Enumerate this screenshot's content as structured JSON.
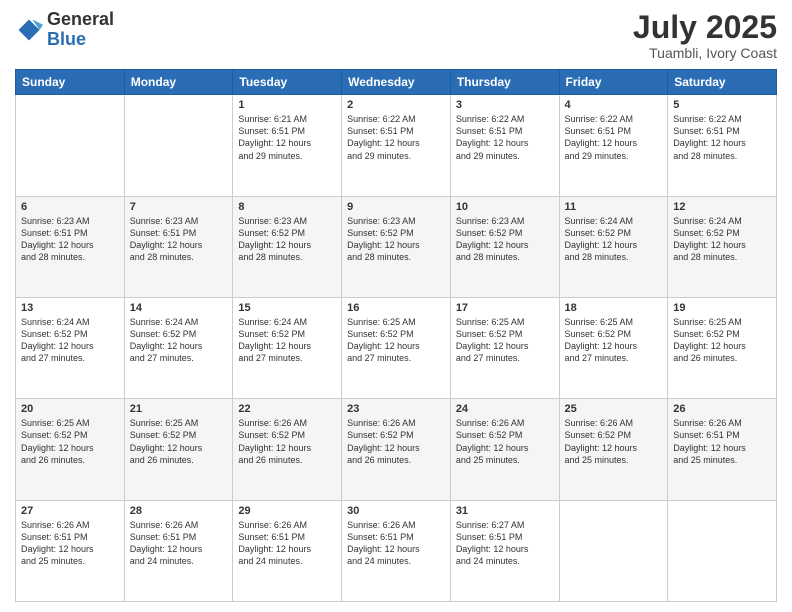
{
  "header": {
    "logo": {
      "general": "General",
      "blue": "Blue"
    },
    "month_year": "July 2025",
    "location": "Tuambli, Ivory Coast"
  },
  "weekdays": [
    "Sunday",
    "Monday",
    "Tuesday",
    "Wednesday",
    "Thursday",
    "Friday",
    "Saturday"
  ],
  "weeks": [
    [
      {
        "day": "",
        "info": ""
      },
      {
        "day": "",
        "info": ""
      },
      {
        "day": "1",
        "sunrise": "6:21 AM",
        "sunset": "6:51 PM",
        "daylight": "12 hours and 29 minutes."
      },
      {
        "day": "2",
        "sunrise": "6:22 AM",
        "sunset": "6:51 PM",
        "daylight": "12 hours and 29 minutes."
      },
      {
        "day": "3",
        "sunrise": "6:22 AM",
        "sunset": "6:51 PM",
        "daylight": "12 hours and 29 minutes."
      },
      {
        "day": "4",
        "sunrise": "6:22 AM",
        "sunset": "6:51 PM",
        "daylight": "12 hours and 29 minutes."
      },
      {
        "day": "5",
        "sunrise": "6:22 AM",
        "sunset": "6:51 PM",
        "daylight": "12 hours and 28 minutes."
      }
    ],
    [
      {
        "day": "6",
        "sunrise": "6:23 AM",
        "sunset": "6:51 PM",
        "daylight": "12 hours and 28 minutes."
      },
      {
        "day": "7",
        "sunrise": "6:23 AM",
        "sunset": "6:51 PM",
        "daylight": "12 hours and 28 minutes."
      },
      {
        "day": "8",
        "sunrise": "6:23 AM",
        "sunset": "6:52 PM",
        "daylight": "12 hours and 28 minutes."
      },
      {
        "day": "9",
        "sunrise": "6:23 AM",
        "sunset": "6:52 PM",
        "daylight": "12 hours and 28 minutes."
      },
      {
        "day": "10",
        "sunrise": "6:23 AM",
        "sunset": "6:52 PM",
        "daylight": "12 hours and 28 minutes."
      },
      {
        "day": "11",
        "sunrise": "6:24 AM",
        "sunset": "6:52 PM",
        "daylight": "12 hours and 28 minutes."
      },
      {
        "day": "12",
        "sunrise": "6:24 AM",
        "sunset": "6:52 PM",
        "daylight": "12 hours and 28 minutes."
      }
    ],
    [
      {
        "day": "13",
        "sunrise": "6:24 AM",
        "sunset": "6:52 PM",
        "daylight": "12 hours and 27 minutes."
      },
      {
        "day": "14",
        "sunrise": "6:24 AM",
        "sunset": "6:52 PM",
        "daylight": "12 hours and 27 minutes."
      },
      {
        "day": "15",
        "sunrise": "6:24 AM",
        "sunset": "6:52 PM",
        "daylight": "12 hours and 27 minutes."
      },
      {
        "day": "16",
        "sunrise": "6:25 AM",
        "sunset": "6:52 PM",
        "daylight": "12 hours and 27 minutes."
      },
      {
        "day": "17",
        "sunrise": "6:25 AM",
        "sunset": "6:52 PM",
        "daylight": "12 hours and 27 minutes."
      },
      {
        "day": "18",
        "sunrise": "6:25 AM",
        "sunset": "6:52 PM",
        "daylight": "12 hours and 27 minutes."
      },
      {
        "day": "19",
        "sunrise": "6:25 AM",
        "sunset": "6:52 PM",
        "daylight": "12 hours and 26 minutes."
      }
    ],
    [
      {
        "day": "20",
        "sunrise": "6:25 AM",
        "sunset": "6:52 PM",
        "daylight": "12 hours and 26 minutes."
      },
      {
        "day": "21",
        "sunrise": "6:25 AM",
        "sunset": "6:52 PM",
        "daylight": "12 hours and 26 minutes."
      },
      {
        "day": "22",
        "sunrise": "6:26 AM",
        "sunset": "6:52 PM",
        "daylight": "12 hours and 26 minutes."
      },
      {
        "day": "23",
        "sunrise": "6:26 AM",
        "sunset": "6:52 PM",
        "daylight": "12 hours and 26 minutes."
      },
      {
        "day": "24",
        "sunrise": "6:26 AM",
        "sunset": "6:52 PM",
        "daylight": "12 hours and 25 minutes."
      },
      {
        "day": "25",
        "sunrise": "6:26 AM",
        "sunset": "6:52 PM",
        "daylight": "12 hours and 25 minutes."
      },
      {
        "day": "26",
        "sunrise": "6:26 AM",
        "sunset": "6:51 PM",
        "daylight": "12 hours and 25 minutes."
      }
    ],
    [
      {
        "day": "27",
        "sunrise": "6:26 AM",
        "sunset": "6:51 PM",
        "daylight": "12 hours and 25 minutes."
      },
      {
        "day": "28",
        "sunrise": "6:26 AM",
        "sunset": "6:51 PM",
        "daylight": "12 hours and 24 minutes."
      },
      {
        "day": "29",
        "sunrise": "6:26 AM",
        "sunset": "6:51 PM",
        "daylight": "12 hours and 24 minutes."
      },
      {
        "day": "30",
        "sunrise": "6:26 AM",
        "sunset": "6:51 PM",
        "daylight": "12 hours and 24 minutes."
      },
      {
        "day": "31",
        "sunrise": "6:27 AM",
        "sunset": "6:51 PM",
        "daylight": "12 hours and 24 minutes."
      },
      {
        "day": "",
        "info": ""
      },
      {
        "day": "",
        "info": ""
      }
    ]
  ]
}
